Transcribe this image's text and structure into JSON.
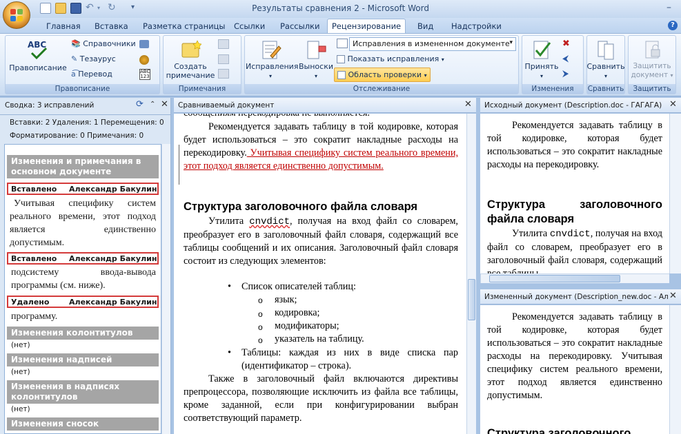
{
  "window": {
    "title": "Результаты сравнения 2 - Microsoft Word"
  },
  "tabs": [
    "Главная",
    "Вставка",
    "Разметка страницы",
    "Ссылки",
    "Рассылки",
    "Рецензирование",
    "Вид",
    "Надстройки"
  ],
  "ribbon": {
    "proofing": {
      "label": "Правописание",
      "spelling": "Правописание",
      "research": "Справочники",
      "thesaurus": "Тезаурус",
      "translate": "Перевод"
    },
    "comments": {
      "label": "Примечания",
      "new_comment": "Создать примечание"
    },
    "tracking": {
      "label": "Отслеживание",
      "track_changes": "Исправления",
      "balloons": "Выноски",
      "display_select": "Исправления в измененном документе",
      "show_markup": "Показать исправления",
      "reviewing_pane": "Область проверки"
    },
    "changes": {
      "label": "Изменения",
      "accept": "Принять"
    },
    "compare": {
      "label": "Сравнить",
      "compare": "Сравнить"
    },
    "protect": {
      "label": "Защитить",
      "protect_doc": "Защитить документ"
    }
  },
  "review_pane": {
    "title": "Сводка: 3 исправлений",
    "summary_line1": "Вставки: 2  Удаления: 1  Перемещения: 0",
    "summary_line2": "Форматирование: 0  Примечания: 0",
    "section_main": "Изменения и примечания в основном документе",
    "items": [
      {
        "type": "Вставлено",
        "author": "Александр Бакулин",
        "text": "Учитывая специфику систем реального времени, этот подход является единственно допустимым."
      },
      {
        "type": "Вставлено",
        "author": "Александр Бакулин",
        "text": "подсистему ввода-вывода программы (см. ниже)."
      },
      {
        "type": "Удалено",
        "author": "Александр Бакулин",
        "text": "программу."
      }
    ],
    "section_headers": "Изменения колонтитулов",
    "section_textboxes": "Изменения надписей",
    "section_header_textboxes": "Изменения в надписях колонтитулов",
    "section_footnotes": "Изменения сносок",
    "none": "(нет)"
  },
  "compared_doc": {
    "title": "Сравниваемый документ",
    "top_cut": "сообщениям перекодировка не выполняется.",
    "p1": "Рекомендуется задавать таблицу в той кодировке, которая будет использоваться – это сократит накладные расходы на перекодировку.",
    "p1_ins": " Учитывая специфику систем реального времени, этот подход является единственно допустимым.",
    "heading": "Структура заголовочного файла словаря",
    "p2_a": "Утилита ",
    "p2_code": "cnvdict",
    "p2_b": ", получая на вход файл со словарем, преобразует его в заголовочный файл словаря, содержащий все таблицы сообщений и их описания. Заголовочный файл словаря состоит из следующих элементов:",
    "bullet1": "Список описателей таблиц:",
    "sub": [
      "язык;",
      "кодировка;",
      "модификаторы;",
      "указатель на таблицу."
    ],
    "bullet2": "Таблицы: каждая из них в виде списка пар (идентификатор – строка).",
    "p3": "Также в заголовочный файл включаются директивы препроцессора, позволяющие исключить из файла все таблицы, кроме заданной, если при конфигурировании выбран соответствующий параметр."
  },
  "original_doc": {
    "title": "Исходный документ (Description.doc - ГАГАГА)",
    "p1": "Рекомендуется задавать таблицу в той кодировке, которая будет использоваться – это сократит накладные расходы на перекодировку.",
    "heading": "Структура заголовочного файла словаря",
    "p2_a": "Утилита ",
    "p2_code": "cnvdict",
    "p2_b": ", получая на вход файл со словарем, преобразует его в заголовочный файл словаря, содержащий все таблицы"
  },
  "revised_doc": {
    "title": "Измененный документ (Description_new.doc - Ал",
    "p1": "Рекомендуется задавать таблицу в той кодировке, которая будет использоваться – это сократит накладные расходы на перекодировку. Учитывая специфику систем реального времени, этот подход является единственно допустимым.",
    "heading": "Структура заголовочного"
  }
}
